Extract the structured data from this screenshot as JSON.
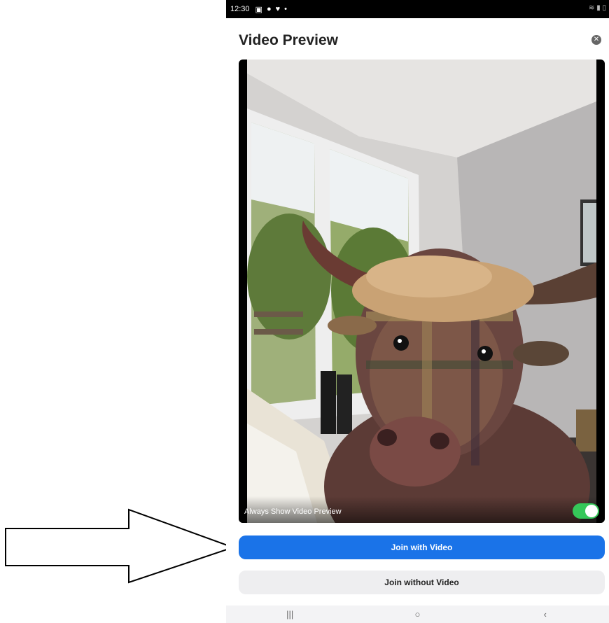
{
  "status_bar": {
    "time": "12:30",
    "icons": [
      "gallery-icon",
      "messenger-icon",
      "vpn-icon",
      "dot-icon"
    ],
    "right_icons": [
      "wifi-icon",
      "signal-icon",
      "battery-icon"
    ]
  },
  "dialog": {
    "title": "Video Preview",
    "close_icon": "close-icon"
  },
  "preview": {
    "always_show_label": "Always Show Video Preview",
    "always_show_enabled": true
  },
  "buttons": {
    "join_with_video": "Join with Video",
    "join_without_video": "Join without Video"
  },
  "nav_bar": {
    "recents": "|||",
    "home": "○",
    "back": "‹"
  },
  "colors": {
    "primary": "#1a73e8",
    "toggle_on": "#35c759",
    "secondary_button": "#eeeef0"
  }
}
